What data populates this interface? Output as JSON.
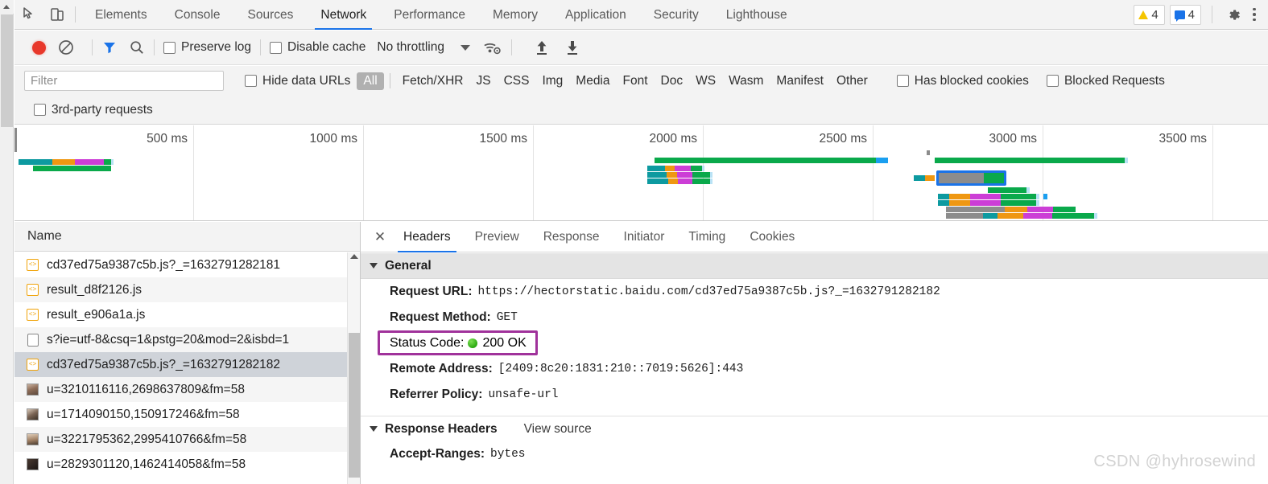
{
  "window": {
    "panel_tabs": [
      {
        "label": "Elements",
        "active": false
      },
      {
        "label": "Console",
        "active": false
      },
      {
        "label": "Sources",
        "active": false
      },
      {
        "label": "Network",
        "active": true
      },
      {
        "label": "Performance",
        "active": false
      },
      {
        "label": "Memory",
        "active": false
      },
      {
        "label": "Application",
        "active": false
      },
      {
        "label": "Security",
        "active": false
      },
      {
        "label": "Lighthouse",
        "active": false
      }
    ],
    "warning_count": "4",
    "message_count": "4",
    "inspect_icon": "inspect-element-icon",
    "device_icon": "device-toolbar-icon",
    "settings_icon": "gear-icon",
    "more_icon": "kebab-menu-icon"
  },
  "controls": {
    "record_label": "record-button",
    "clear_label": "clear-button",
    "filter_icon_label": "filter-funnel-icon",
    "search_icon_label": "search-icon",
    "preserve_log": "Preserve log",
    "disable_cache": "Disable cache",
    "throttling": "No throttling",
    "wifi_icon": "network-conditions-icon",
    "import_icon": "import-har-icon",
    "export_icon": "export-har-icon"
  },
  "filters": {
    "placeholder": "Filter",
    "value": "",
    "hide_data_urls": "Hide data URLs",
    "types": [
      {
        "label": "All",
        "selected": true
      },
      {
        "label": "Fetch/XHR",
        "selected": false
      },
      {
        "label": "JS",
        "selected": false
      },
      {
        "label": "CSS",
        "selected": false
      },
      {
        "label": "Img",
        "selected": false
      },
      {
        "label": "Media",
        "selected": false
      },
      {
        "label": "Font",
        "selected": false
      },
      {
        "label": "Doc",
        "selected": false
      },
      {
        "label": "WS",
        "selected": false
      },
      {
        "label": "Wasm",
        "selected": false
      },
      {
        "label": "Manifest",
        "selected": false
      },
      {
        "label": "Other",
        "selected": false
      }
    ],
    "has_blocked_cookies": "Has blocked cookies",
    "blocked_requests": "Blocked Requests",
    "third_party_requests": "3rd-party requests"
  },
  "overview": {
    "ticks": [
      "500 ms",
      "1000 ms",
      "1500 ms",
      "2000 ms",
      "2500 ms",
      "3000 ms",
      "3500 ms"
    ],
    "colors": {
      "queueing": "#0d9aa0",
      "stalled": "#ef9712",
      "ssl": "#cc3ed6",
      "download": "#0aa94b",
      "waiting": "#1a9ff0",
      "blocked": "#8c8c8c",
      "selection": "#1a73e8"
    }
  },
  "requests": {
    "column_name": "Name",
    "rows": [
      {
        "name": "cd37ed75a9387c5b.js?_=1632791282181",
        "icon": "js-file-icon",
        "selected": false
      },
      {
        "name": "result_d8f2126.js",
        "icon": "js-file-icon",
        "selected": false
      },
      {
        "name": "result_e906a1a.js",
        "icon": "js-file-icon",
        "selected": false
      },
      {
        "name": "s?ie=utf-8&csq=1&pstg=20&mod=2&isbd=1",
        "icon": "document-icon",
        "selected": false
      },
      {
        "name": "cd37ed75a9387c5b.js?_=1632791282182",
        "icon": "js-file-icon",
        "selected": true
      },
      {
        "name": "u=3210116116,2698637809&fm=58",
        "icon": "image-thumbnail-icon",
        "selected": false
      },
      {
        "name": "u=1714090150,150917246&fm=58",
        "icon": "image-thumbnail-icon",
        "selected": false
      },
      {
        "name": "u=3221795362,2995410766&fm=58",
        "icon": "image-thumbnail-icon",
        "selected": false
      },
      {
        "name": "u=2829301120,1462414058&fm=58",
        "icon": "image-thumbnail-icon",
        "selected": false
      }
    ]
  },
  "detail": {
    "close_label": "✕",
    "tabs": [
      {
        "label": "Headers",
        "active": true
      },
      {
        "label": "Preview",
        "active": false
      },
      {
        "label": "Response",
        "active": false
      },
      {
        "label": "Initiator",
        "active": false
      },
      {
        "label": "Timing",
        "active": false
      },
      {
        "label": "Cookies",
        "active": false
      }
    ],
    "general": {
      "title": "General",
      "request_url_key": "Request URL:",
      "request_url_value": "https://hectorstatic.baidu.com/cd37ed75a9387c5b.js?_=1632791282182",
      "request_method_key": "Request Method:",
      "request_method_value": "GET",
      "status_code_key": "Status Code:",
      "status_code_value": "200 OK",
      "status_indicator": "green-status-dot",
      "remote_address_key": "Remote Address:",
      "remote_address_value": "[2409:8c20:1831:210::7019:5626]:443",
      "referrer_policy_key": "Referrer Policy:",
      "referrer_policy_value": "unsafe-url"
    },
    "response_headers": {
      "title": "Response Headers",
      "view_source": "View source",
      "rows": [
        {
          "key": "Accept-Ranges:",
          "value": "bytes"
        }
      ]
    },
    "highlight_color": "#a0329b"
  },
  "watermark": "CSDN @hyhrosewind"
}
